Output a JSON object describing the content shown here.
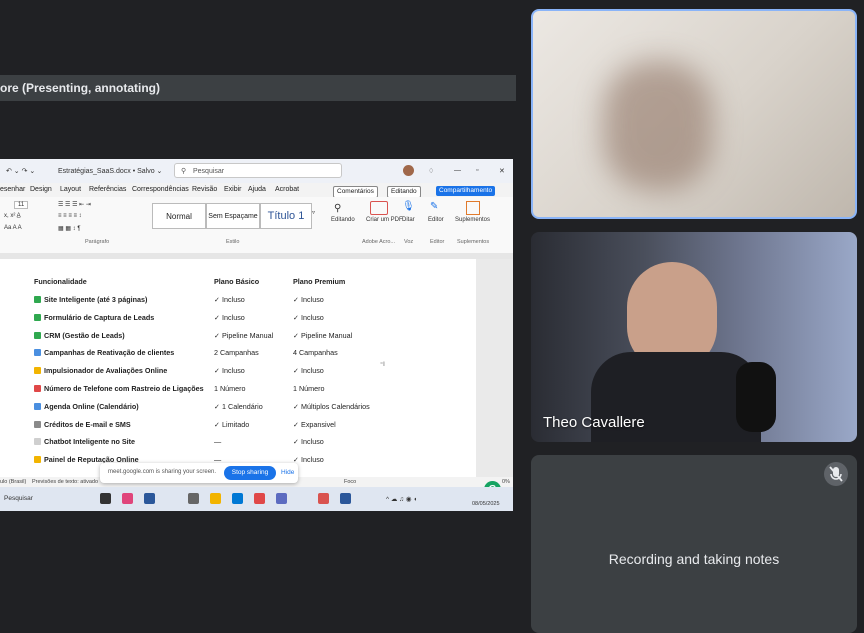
{
  "banner": {
    "text": "ore (Presenting, annotating)"
  },
  "shared_screen": {
    "titlebar": {
      "file_name": "Estratégias_SaaS.docx • Salvo ⌄",
      "search_placeholder": "Pesquisar"
    },
    "menubar": {
      "items": [
        "esenhar",
        "Design",
        "Layout",
        "Referências",
        "Correspondências",
        "Revisão",
        "Exibir",
        "Ajuda",
        "Acrobat"
      ],
      "comments_label": "Comentários",
      "editing_label": "Editando",
      "share_label": "Compartilhamento"
    },
    "ribbon": {
      "font_size": "11",
      "styles": [
        "Normal",
        "Sem Espaçame",
        "Título 1"
      ],
      "group_labels": [
        "Parágrafo",
        "Estilo",
        "Adobe Acro...",
        "Voz",
        "Editor",
        "Suplementos"
      ],
      "tools": [
        "Editando",
        "Criar um PDF",
        "Ditar",
        "Editor",
        "Suplementos"
      ]
    },
    "table": {
      "headers": [
        "Funcionalidade",
        "Plano Básico",
        "Plano Premium"
      ],
      "rows": [
        {
          "feature": "Site Inteligente (até 3 páginas)",
          "basic": "✓ Incluso",
          "premium": "✓ Incluso",
          "icon": "#2fa84f"
        },
        {
          "feature": "Formulário de Captura de Leads",
          "basic": "✓ Incluso",
          "premium": "✓ Incluso",
          "icon": "#2fa84f"
        },
        {
          "feature": "CRM (Gestão de Leads)",
          "basic": "✓ Pipeline Manual",
          "premium": "✓ Pipeline Manual",
          "icon": "#2fa84f"
        },
        {
          "feature": "Campanhas de Reativação de clientes",
          "basic": "2 Campanhas",
          "premium": "4 Campanhas",
          "icon": "#4a8fe0"
        },
        {
          "feature": "Impulsionador de Avaliações Online",
          "basic": "✓ Incluso",
          "premium": "✓ Incluso",
          "icon": "#f2b400"
        },
        {
          "feature": "Número de Telefone com Rastreio de Ligações",
          "basic": "1 Número",
          "premium": "1 Número",
          "icon": "#e04848"
        },
        {
          "feature": "Agenda Online (Calendário)",
          "basic": "✓ 1 Calendário",
          "premium": "✓ Múltiplos Calendários",
          "icon": "#4a8fe0"
        },
        {
          "feature": "Créditos de E-mail e SMS",
          "basic": "✓ Limitado",
          "premium": "✓ Expansivel",
          "icon": "#8a8a8a"
        },
        {
          "feature": "Chatbot Inteligente no Site",
          "basic": "—",
          "premium": "✓ Incluso",
          "icon": "#cfcfcf"
        },
        {
          "feature": "Painel de Reputação Online",
          "basic": "—",
          "premium": "✓ Incluso",
          "icon": "#f2b400"
        }
      ]
    },
    "statusbar": {
      "left": "ulo (Brasil)",
      "accessibility": "Previsões de texto: ativado",
      "focus": "Foco",
      "zoom": "0%"
    },
    "share_notice": {
      "text": "meet.google.com is sharing your screen.",
      "stop_label": "Stop sharing",
      "hide_label": "Hide"
    },
    "taskbar": {
      "search_placeholder": "Pesquisar",
      "date": "08/05/2025"
    }
  },
  "participants": [
    {
      "name": "",
      "blurred": true
    },
    {
      "name": "Theo Cavallere"
    },
    {
      "status_text": "Recording and taking notes",
      "muted": true
    }
  ]
}
